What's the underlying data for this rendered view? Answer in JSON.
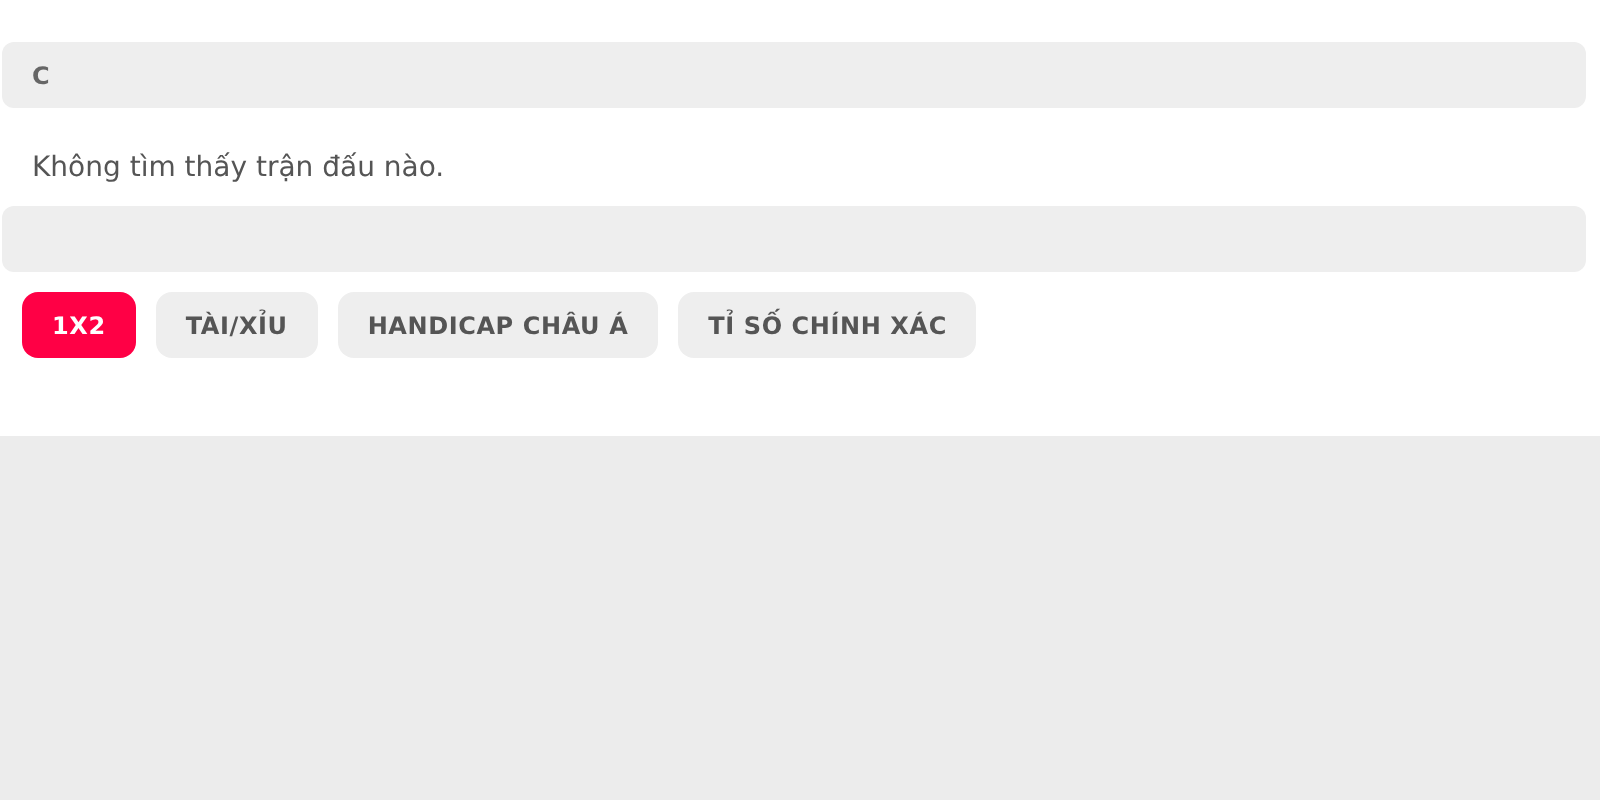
{
  "header_bar": {
    "label": "C"
  },
  "message": "Không tìm thấy trận đấu nào.",
  "tabs": [
    {
      "label": "1X2",
      "selected": true
    },
    {
      "label": "TÀI/XỈU",
      "selected": false
    },
    {
      "label": "HANDICAP CHÂU Á",
      "selected": false
    },
    {
      "label": "TỈ SỐ CHÍNH XÁC",
      "selected": false
    }
  ]
}
